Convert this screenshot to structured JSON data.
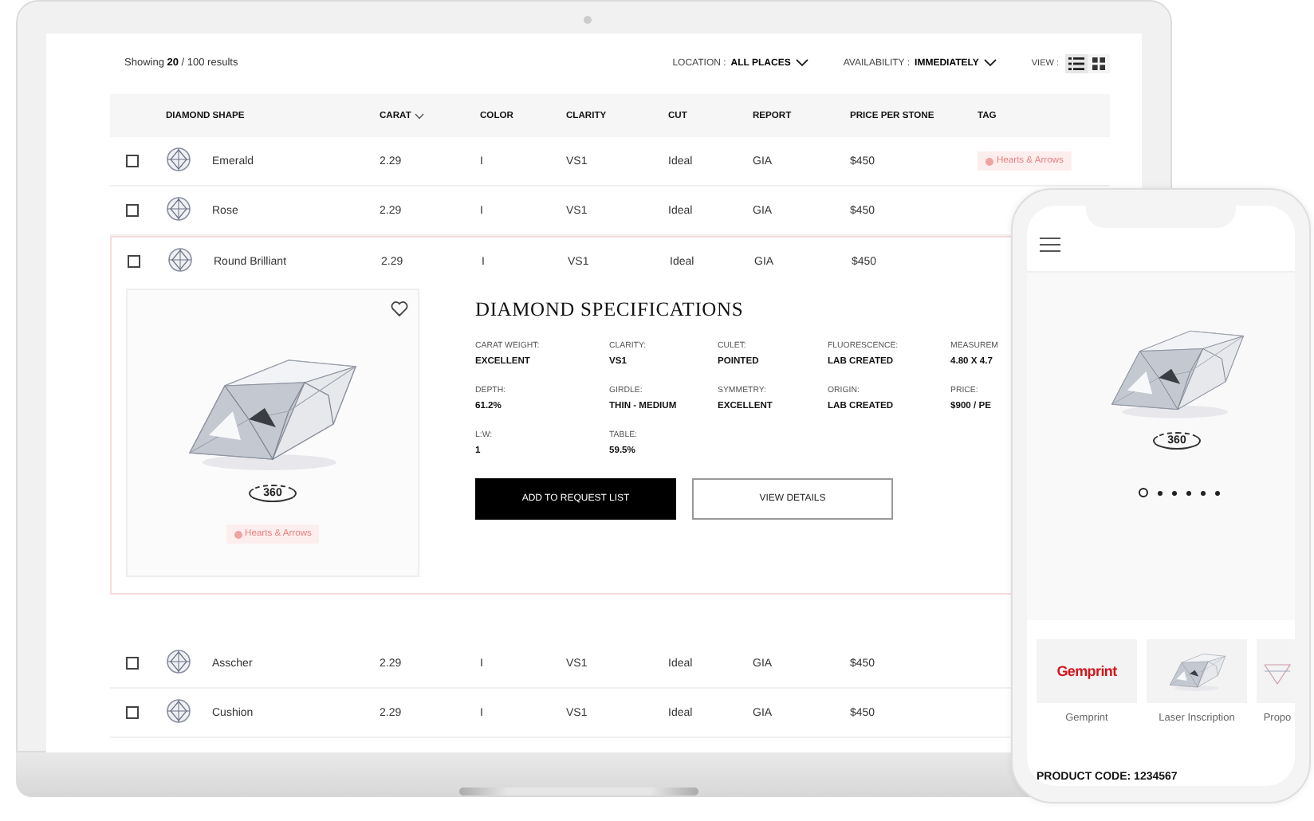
{
  "laptop": {
    "summary": "Showing **20** / 100 results",
    "filters": [
      {
        "label": "LOCATION :",
        "value": "ALL PLACES"
      },
      {
        "label": "AVAILABILITY :",
        "value": "IMMEDIATELY"
      }
    ],
    "view": {
      "label": "VIEW :",
      "options": [
        {
          "kind": "list",
          "selected": true
        },
        {
          "kind": "grid",
          "selected": false
        }
      ]
    },
    "table": {
      "columns": [
        {
          "label": "DIAMOND SHAPE",
          "sorted": false
        },
        {
          "label": "CARAT",
          "sorted": true
        },
        {
          "label": "COLOR",
          "sorted": false
        },
        {
          "label": "CLARITY",
          "sorted": false
        },
        {
          "label": "CUT",
          "sorted": false
        },
        {
          "label": "REPORT",
          "sorted": false
        },
        {
          "label": "PRICE PER STONE",
          "sorted": false
        },
        {
          "label": "TAG",
          "sorted": false
        }
      ],
      "rows": [
        {
          "checked": false,
          "expanded": false,
          "shape": "Emerald",
          "carat": "2.29",
          "color_grade": "I",
          "clarity": "VS1",
          "cut": "Ideal",
          "report": "GIA",
          "price": "$450",
          "tag": "Hearts & Arrows"
        },
        {
          "checked": false,
          "expanded": false,
          "shape": "Rose",
          "carat": "2.29",
          "color_grade": "I",
          "clarity": "VS1",
          "cut": "Ideal",
          "report": "GIA",
          "price": "$450"
        },
        {
          "checked": false,
          "expanded": true,
          "shape": "Round Brilliant",
          "carat": "2.29",
          "color_grade": "I",
          "clarity": "VS1",
          "cut": "Ideal",
          "report": "GIA",
          "price": "$450",
          "details": {
            "title": "DIAMOND SPECIFICATIONS",
            "rotate_label": "360",
            "tag": "Hearts & Arrows",
            "specs": [
              {
                "label": "CARAT WEIGHT:",
                "value": "EXCELLENT"
              },
              {
                "label": "CLARITY:",
                "value": "VS1"
              },
              {
                "label": "CULET:",
                "value": "POINTED"
              },
              {
                "label": "FLUORESCENCE:",
                "value": "LAB CREATED"
              },
              {
                "label": "MEASUREM",
                "value": "4.80 X 4.7"
              },
              {
                "label": "DEPTH:",
                "value": "61.2%"
              },
              {
                "label": "GIRDLE:",
                "value": "THIN - MEDIUM"
              },
              {
                "label": "SYMMETRY:",
                "value": "EXCELLENT"
              },
              {
                "label": "ORIGIN:",
                "value": "LAB CREATED"
              },
              {
                "label": "PRICE:",
                "value": "$900 / PE"
              },
              {
                "label": "L:W:",
                "value": "1"
              },
              {
                "label": "TABLE:",
                "value": "59.5%"
              }
            ],
            "buttons": [
              {
                "label": "ADD TO REQUEST LIST",
                "kind": "primary"
              },
              {
                "label": "VIEW DETAILS",
                "kind": "secondary"
              }
            ]
          }
        },
        {
          "checked": false,
          "expanded": false,
          "shape": "Asscher",
          "carat": "2.29",
          "color_grade": "I",
          "clarity": "VS1",
          "cut": "Ideal",
          "report": "GIA",
          "price": "$450"
        },
        {
          "checked": false,
          "expanded": false,
          "shape": "Cushion",
          "carat": "2.29",
          "color_grade": "I",
          "clarity": "VS1",
          "cut": "Ideal",
          "report": "GIA",
          "price": "$450"
        }
      ]
    }
  },
  "phone": {
    "rotate_label": "360",
    "slides": [
      {
        "selected": true
      },
      {
        "selected": false
      },
      {
        "selected": false
      },
      {
        "selected": false
      },
      {
        "selected": false
      },
      {
        "selected": false
      }
    ],
    "features": [
      {
        "kind": "logo",
        "logo": "Gemprint",
        "label": "Gemprint"
      },
      {
        "kind": "photo",
        "label": "Laser Inscription"
      },
      {
        "kind": "diagram",
        "label": "Propo"
      }
    ],
    "product_code": "PRODUCT CODE: 1234567"
  }
}
